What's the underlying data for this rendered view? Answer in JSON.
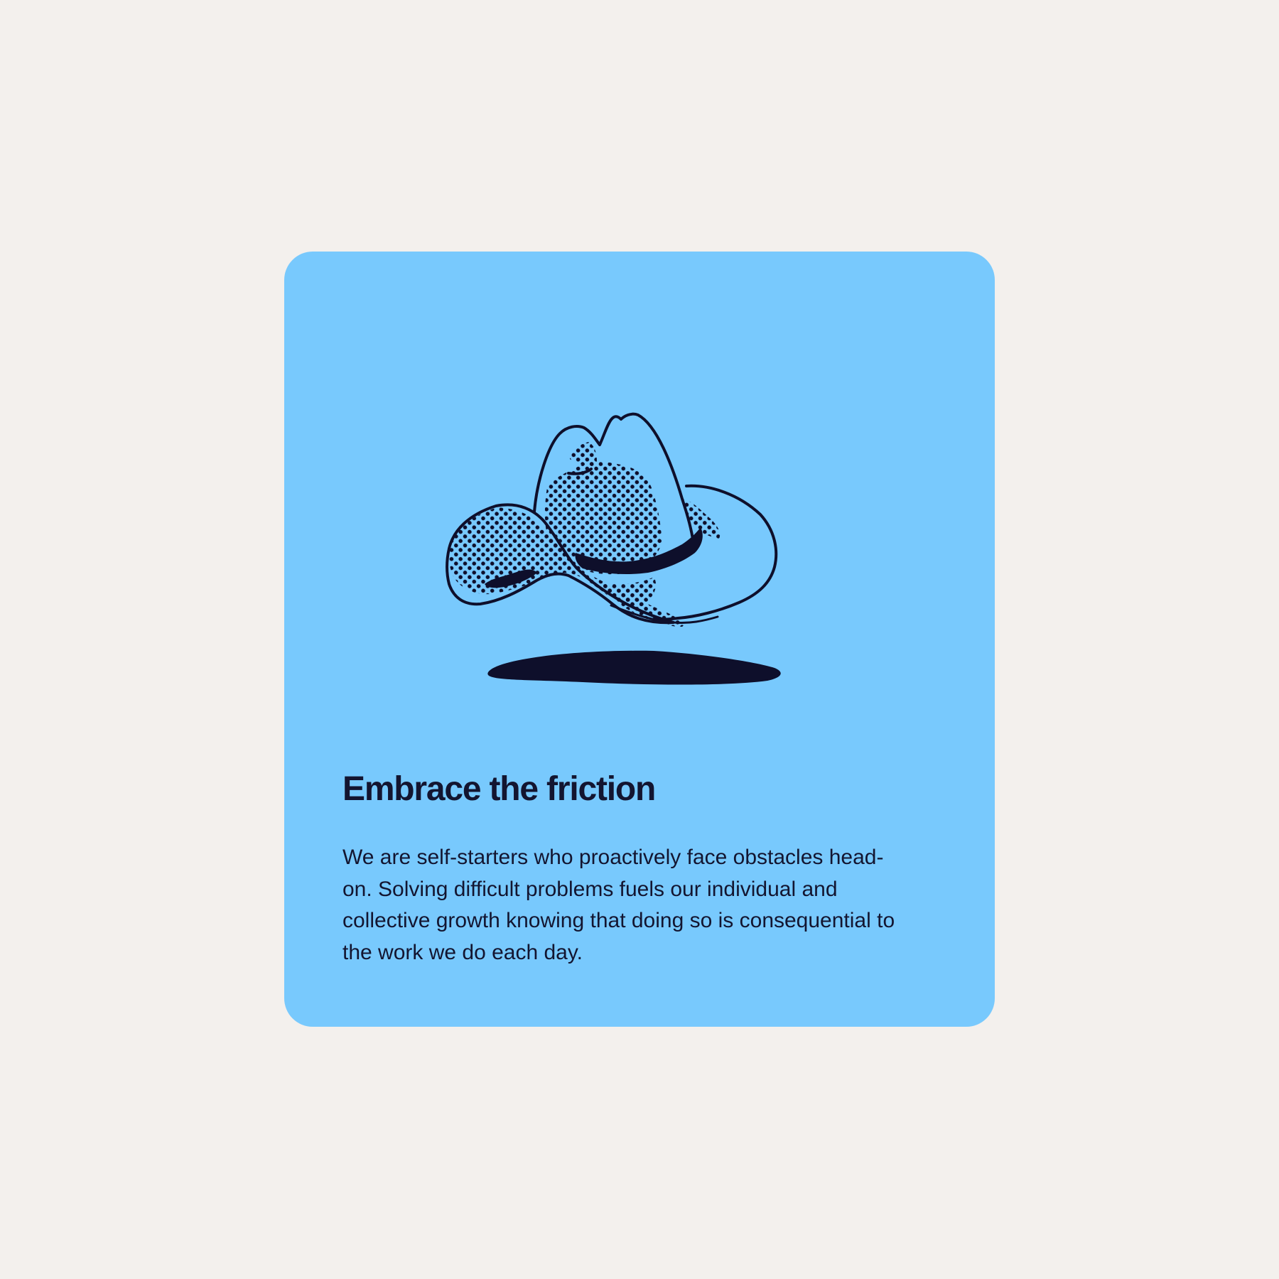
{
  "background_color": "#f3f0ed",
  "card": {
    "background_color": "#78c9fd",
    "text_color": "#131530",
    "illustration_icon": "cowboy-hat-icon",
    "title": "Embrace the friction",
    "body": "We are self-starters who proactively face obstacles head-on. Solving difficult problems fuels our individual and collective growth knowing that doing so is consequential to the work we do each day."
  }
}
